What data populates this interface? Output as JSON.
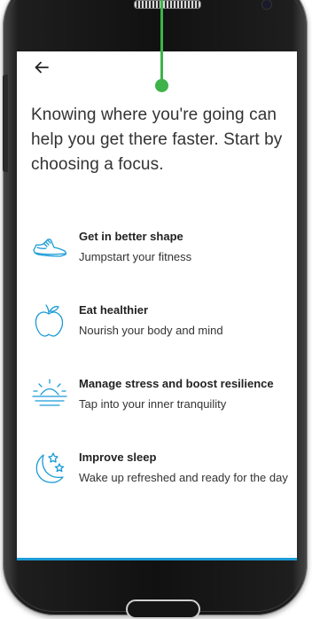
{
  "intro_text": "Knowing where you're going can help you get there faster. Start by choosing a focus.",
  "focus_options": [
    {
      "icon": "sneaker-icon",
      "title": "Get in better shape",
      "subtitle": "Jumpstart your fitness"
    },
    {
      "icon": "apple-icon",
      "title": "Eat healthier",
      "subtitle": "Nourish your body and mind"
    },
    {
      "icon": "sunrise-icon",
      "title": "Manage stress and boost resilience",
      "subtitle": "Tap into your inner tranquility"
    },
    {
      "icon": "moon-stars-icon",
      "title": "Improve sleep",
      "subtitle": "Wake up refreshed and ready for the day"
    }
  ],
  "colors": {
    "icon_blue": "#1b9bd6",
    "callout_green": "#3db34a",
    "text_dark": "#333333"
  }
}
